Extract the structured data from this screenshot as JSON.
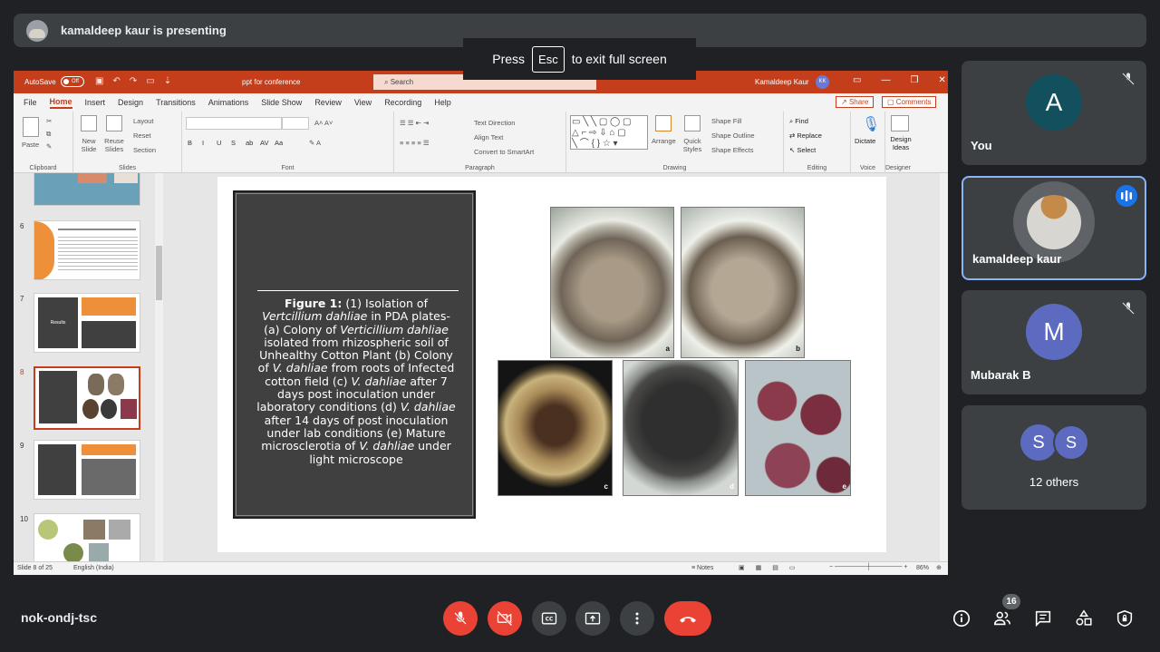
{
  "presenting_banner": {
    "text": "kamaldeep kaur is presenting"
  },
  "fullscreen_toast": {
    "pre": "Press",
    "key": "Esc",
    "post": "to exit full screen"
  },
  "ppt": {
    "autosave_label": "AutoSave",
    "autosave_state": "Off",
    "doc_title": "ppt for conference",
    "search_placeholder": "Search",
    "user_name": "Kamaldeep Kaur",
    "user_initials": "KK",
    "tabs": [
      "File",
      "Home",
      "Insert",
      "Design",
      "Transitions",
      "Animations",
      "Slide Show",
      "Review",
      "View",
      "Recording",
      "Help"
    ],
    "active_tab": "Home",
    "share_label": "Share",
    "comments_label": "Comments",
    "ribbon": {
      "clipboard": {
        "label": "Clipboard",
        "paste": "Paste"
      },
      "slides": {
        "label": "Slides",
        "new_slide": "New Slide",
        "reuse_slides": "Reuse Slides",
        "layout": "Layout",
        "reset": "Reset",
        "section": "Section"
      },
      "font": {
        "label": "Font",
        "buttons": [
          "B",
          "I",
          "U",
          "S",
          "ab",
          "AV",
          "Aa"
        ]
      },
      "paragraph": {
        "label": "Paragraph",
        "text_direction": "Text Direction",
        "align_text": "Align Text",
        "convert_smartart": "Convert to SmartArt"
      },
      "drawing": {
        "label": "Drawing",
        "arrange": "Arrange",
        "quick_styles": "Quick Styles",
        "shape_fill": "Shape Fill",
        "shape_outline": "Shape Outline",
        "shape_effects": "Shape Effects"
      },
      "editing": {
        "label": "Editing",
        "find": "Find",
        "replace": "Replace",
        "select": "Select"
      },
      "voice": {
        "label": "Voice",
        "dictate": "Dictate"
      },
      "designer": {
        "label": "Designer",
        "design_ideas": "Design Ideas"
      }
    },
    "thumbnails": [
      {
        "num": "",
        "selected": false
      },
      {
        "num": "6",
        "selected": false
      },
      {
        "num": "7",
        "selected": false,
        "title": "Results"
      },
      {
        "num": "8",
        "selected": true
      },
      {
        "num": "9",
        "selected": false
      },
      {
        "num": "10",
        "selected": false
      }
    ],
    "slide": {
      "caption_bold": "Figure 1:",
      "caption_parts": [
        " (1) Isolation of ",
        "Vertcillium dahliae",
        " in PDA plates- (a) Colony of ",
        "Verticillium dahliae",
        " isolated from rhizospheric soil of Unhealthy Cotton Plant (b) Colony of ",
        "V. dahliae",
        " from roots of Infected cotton field (c) ",
        "V. dahliae",
        " after 7 days post inoculation under laboratory conditions (d) ",
        "V. dahliae",
        " after 14 days of post inoculation under lab conditions (e) Mature microsclerotia of ",
        "V. dahliae",
        " under light microscope"
      ],
      "photo_labels": [
        "a",
        "b",
        "c",
        "d",
        "e"
      ]
    },
    "status": {
      "slide_count": "Slide 8 of 25",
      "language": "English (India)",
      "notes": "Notes",
      "zoom": "86%"
    }
  },
  "participants": [
    {
      "name": "You",
      "initial": "A",
      "avatar_color": "#12505e",
      "muted": true
    },
    {
      "name": "kamaldeep kaur",
      "initial": "",
      "speaking": true
    },
    {
      "name": "Mubarak B",
      "initial": "M",
      "avatar_color": "#5c6bc0",
      "muted": true
    },
    {
      "others_label": "12 others",
      "initials": [
        "S",
        "S"
      ],
      "avatar_color": "#5c6bc0"
    }
  ],
  "bottom_bar": {
    "meeting_code": "nok-ondj-tsc",
    "people_count": "16"
  },
  "colors": {
    "accent_red": "#ea4335",
    "ppt_brand": "#c43e1c",
    "speaking_blue": "#1a73e8",
    "tile_bg": "#3c4043"
  }
}
